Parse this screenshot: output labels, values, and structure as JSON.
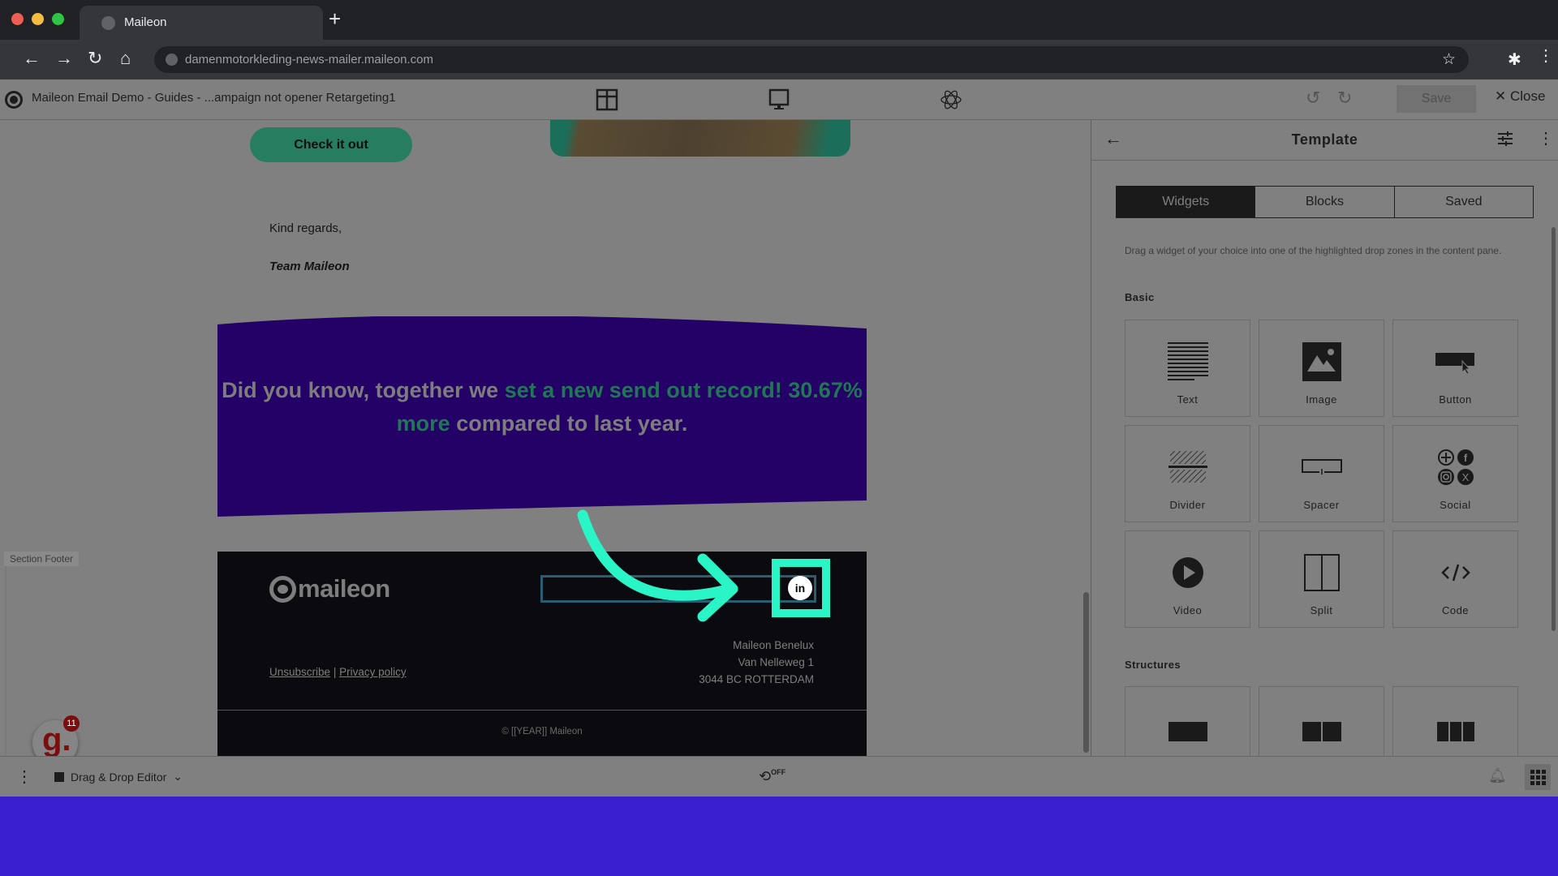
{
  "browser": {
    "tab_title": "Maileon",
    "new_tab": "+",
    "url": "damenmotorkleding-news-mailer.maileon.com",
    "nav": {
      "back": "←",
      "forward": "→",
      "reload": "↻",
      "home": "⌂"
    }
  },
  "app_header": {
    "title": "Maileon Email Demo - Guides - ...ampaign not opener Retargeting1",
    "save_label": "Save",
    "close_label": "Close",
    "close_glyph": "✕",
    "undo": "↺",
    "redo": "↻"
  },
  "email": {
    "cta_label": "Check it out",
    "closing": "Kind regards,",
    "signature": "Team Maileon",
    "banner": {
      "part1": "Did you know, together we ",
      "highlight1": "set a new send out record! 30.67% more",
      "part2": " compared to last year.",
      "bg_color": "#230166",
      "highlight_color": "#217656"
    },
    "section_label": "Section Footer",
    "footer": {
      "logo_text": "maileon",
      "social_icon": "in",
      "company": "Maileon Benelux",
      "street": "Van Nelleweg 1",
      "city": "3044 BC  ROTTERDAM",
      "unsubscribe": "Unsubscribe",
      "separator": "|",
      "privacy": "Privacy policy",
      "copyright": "© [[YEAR]] Maileon"
    },
    "annotation_color": "#2af5c7"
  },
  "guide_widget": {
    "letter": "g.",
    "badge": "11"
  },
  "panel": {
    "title": "Template",
    "back": "←",
    "more": "⋮",
    "tabs": [
      {
        "label": "Widgets",
        "active": true
      },
      {
        "label": "Blocks",
        "active": false
      },
      {
        "label": "Saved",
        "active": false
      }
    ],
    "description": "Drag a widget of your choice into one of the highlighted drop zones in the content pane.",
    "basic_heading": "Basic",
    "widgets": [
      {
        "label": "Text",
        "icon": "text-icon"
      },
      {
        "label": "Image",
        "icon": "image-icon"
      },
      {
        "label": "Button",
        "icon": "button-icon"
      },
      {
        "label": "Divider",
        "icon": "divider-icon"
      },
      {
        "label": "Spacer",
        "icon": "spacer-icon"
      },
      {
        "label": "Social",
        "icon": "social-icon"
      },
      {
        "label": "Video",
        "icon": "video-icon"
      },
      {
        "label": "Split",
        "icon": "split-icon"
      },
      {
        "label": "Code",
        "icon": "code-icon"
      }
    ],
    "structures_heading": "Structures",
    "structures": [
      {
        "columns": 1
      },
      {
        "columns": 2
      },
      {
        "columns": 3
      }
    ]
  },
  "bottom_bar": {
    "editor_label": "Drag & Drop Editor",
    "editor_chevron": "⌄",
    "autosave_status": "OFF",
    "menu": "⋮"
  }
}
